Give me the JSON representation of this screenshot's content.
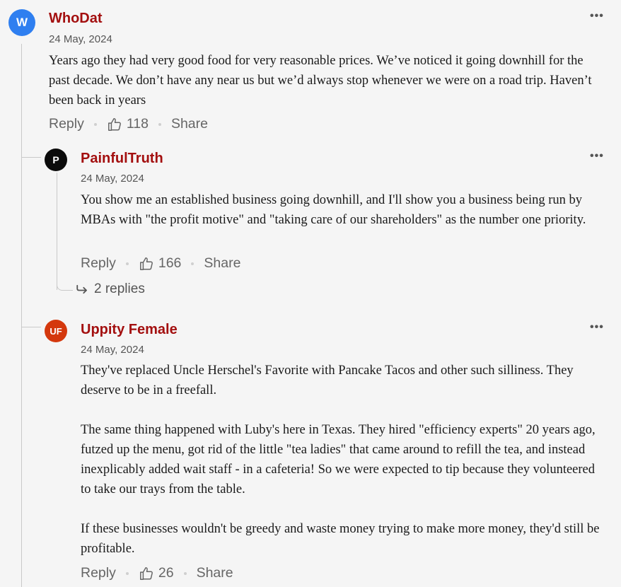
{
  "comments": [
    {
      "avatar": "W",
      "author": "WhoDat",
      "date": "24 May, 2024",
      "text": "Years ago they had very good food for very reasonable prices. We’ve noticed it going downhill for the past decade. We don’t have any near us but we’d always stop whenever we were on a road trip. Haven’t been back in years",
      "reply_label": "Reply",
      "likes": "118",
      "share_label": "Share"
    },
    {
      "avatar": "P",
      "author": "PainfulTruth",
      "date": "24 May, 2024",
      "text": "You show me an established business going downhill, and I'll show you a business being run by MBAs with \"the profit motive\" and \"taking care of our shareholders\" as the number one priority.",
      "reply_label": "Reply",
      "likes": "166",
      "share_label": "Share",
      "replies_label": "2 replies"
    },
    {
      "avatar": "UF",
      "author": "Uppity Female",
      "date": "24 May, 2024",
      "paragraphs": [
        "They've replaced Uncle Herschel's Favorite with Pancake Tacos and other such silliness. They deserve to be in a freefall.",
        "The same thing happened with Luby's here in Texas. They hired \"efficiency experts\" 20 years ago, futzed up the menu, got rid of the little \"tea ladies\" that came around to refill the tea, and instead inexplicably added wait staff - in a cafeteria! So we were expected to tip because they volunteered to take our trays from the table.",
        "If these businesses wouldn't be greedy and waste money trying to make more money, they'd still be profitable."
      ],
      "reply_label": "Reply",
      "likes": "26",
      "share_label": "Share"
    }
  ],
  "more_icon": "more-horizontal-icon",
  "like_icon": "thumbs-up-icon",
  "replies_icon": "reply-arrow-icon",
  "colors": {
    "author": "#a30f0f",
    "avatar_w": "#2f7ff0",
    "avatar_p": "#0b0b0b",
    "avatar_uf": "#d4380d"
  }
}
